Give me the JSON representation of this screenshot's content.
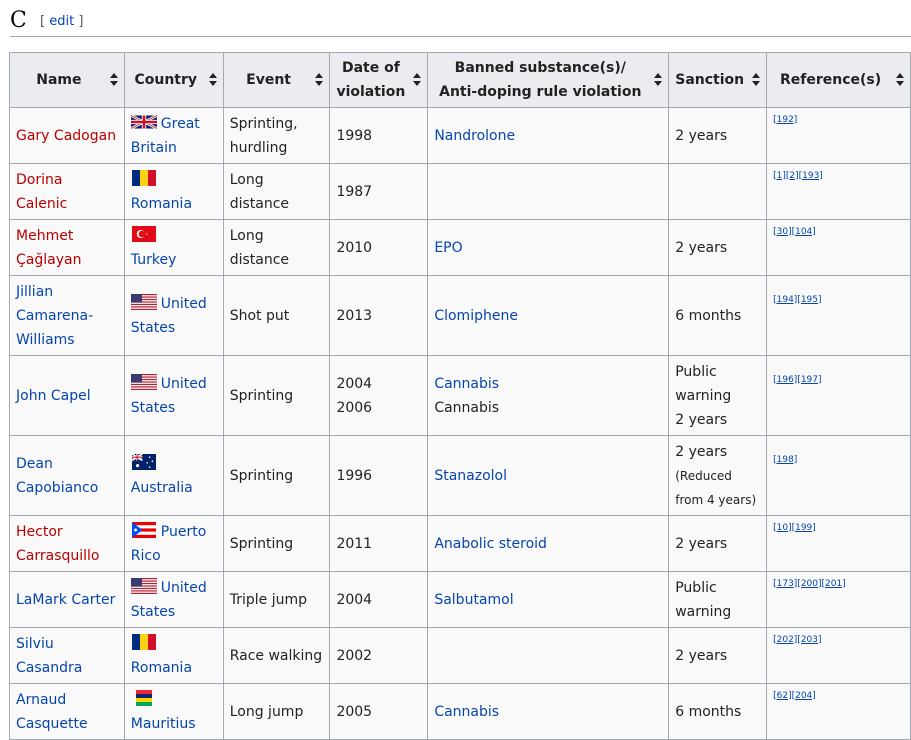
{
  "section": {
    "letter": "C",
    "edit_open": "[ ",
    "edit_label": "edit",
    "edit_close": " ]"
  },
  "columns": [
    "Name",
    "Country",
    "Event",
    "Date of violation",
    "Banned substance(s)/ Anti-doping rule violation",
    "Sanction",
    "Reference(s)"
  ],
  "column_lines": {
    "date": [
      "Date of",
      "violation"
    ],
    "substance": [
      "Banned substance(s)/",
      "Anti-doping rule violation"
    ]
  },
  "rows": [
    {
      "name": [
        "Gary Cadogan"
      ],
      "name_link": "red",
      "flag": "uk-flag-icon",
      "country": [
        "Great",
        "Britain"
      ],
      "event": [
        "Sprinting,",
        "hurdling"
      ],
      "date": [
        "1998"
      ],
      "substance": [
        {
          "text": "Nandrolone",
          "link": true
        }
      ],
      "sanction": [
        "2 years"
      ],
      "refs": "[192]"
    },
    {
      "name": [
        "Dorina Calenic"
      ],
      "name_link": "red",
      "flag": "romania-flag-icon",
      "country": [
        "Romania"
      ],
      "event": [
        "Long",
        "distance"
      ],
      "date": [
        "1987"
      ],
      "substance": [],
      "sanction": [],
      "refs": "[1][2][193]"
    },
    {
      "name": [
        "Mehmet",
        "Çağlayan"
      ],
      "name_link": "red",
      "flag": "turkey-flag-icon",
      "country": [
        "Turkey"
      ],
      "event": [
        "Long",
        "distance"
      ],
      "date": [
        "2010"
      ],
      "substance": [
        {
          "text": "EPO",
          "link": true
        }
      ],
      "sanction": [
        "2 years"
      ],
      "refs": "[30][104]"
    },
    {
      "name": [
        "Jillian",
        "Camarena-",
        "Williams"
      ],
      "name_link": "blue",
      "flag": "usa-flag-icon",
      "country": [
        "United",
        "States"
      ],
      "event": [
        "Shot put"
      ],
      "date": [
        "2013"
      ],
      "substance": [
        {
          "text": "Clomiphene",
          "link": true
        }
      ],
      "sanction": [
        "6 months"
      ],
      "refs": "[194][195]"
    },
    {
      "name": [
        "John Capel"
      ],
      "name_link": "blue",
      "flag": "usa-flag-icon",
      "country": [
        "United",
        "States"
      ],
      "event": [
        "Sprinting"
      ],
      "date": [
        "2004",
        "2006"
      ],
      "substance": [
        {
          "text": "Cannabis",
          "link": true
        },
        {
          "text": "Cannabis",
          "link": false
        }
      ],
      "sanction": [
        "Public",
        "warning",
        "2 years"
      ],
      "refs": "[196][197]"
    },
    {
      "name": [
        "Dean",
        "Capobianco"
      ],
      "name_link": "blue",
      "flag": "australia-flag-icon",
      "country": [
        "Australia"
      ],
      "event": [
        "Sprinting"
      ],
      "date": [
        "1996"
      ],
      "substance": [
        {
          "text": "Stanazolol",
          "link": true
        }
      ],
      "sanction": [
        "2 years"
      ],
      "sanction_note": [
        "(Reduced",
        "from 4 years)"
      ],
      "refs": "[198]"
    },
    {
      "name": [
        "Hector",
        "Carrasquillo"
      ],
      "name_link": "red",
      "flag": "puerto-rico-flag-icon",
      "country": [
        "Puerto",
        "Rico"
      ],
      "event": [
        "Sprinting"
      ],
      "date": [
        "2011"
      ],
      "substance": [
        {
          "text": "Anabolic steroid",
          "link": true
        }
      ],
      "sanction": [
        "2 years"
      ],
      "refs": "[10][199]"
    },
    {
      "name": [
        "LaMark Carter"
      ],
      "name_link": "blue",
      "flag": "usa-flag-icon",
      "country": [
        "United",
        "States"
      ],
      "event": [
        "Triple jump"
      ],
      "date": [
        "2004"
      ],
      "substance": [
        {
          "text": "Salbutamol",
          "link": true
        }
      ],
      "sanction": [
        "Public",
        "warning"
      ],
      "refs": "[173][200][201]"
    },
    {
      "name": [
        "Silviu",
        "Casandra"
      ],
      "name_link": "blue",
      "flag": "romania-flag-icon",
      "country": [
        "Romania"
      ],
      "event": [
        "Race walking"
      ],
      "date": [
        "2002"
      ],
      "substance": [],
      "sanction": [
        "2 years"
      ],
      "refs": "[202][203]"
    },
    {
      "name": [
        "Arnaud",
        "Casquette"
      ],
      "name_link": "blue",
      "flag": "mauritius-flag-icon",
      "country": [
        "Mauritius"
      ],
      "event": [
        "Long jump"
      ],
      "date": [
        "2005"
      ],
      "substance": [
        {
          "text": "Cannabis",
          "link": true
        }
      ],
      "sanction": [
        "6 months"
      ],
      "refs": "[62][204]"
    }
  ]
}
